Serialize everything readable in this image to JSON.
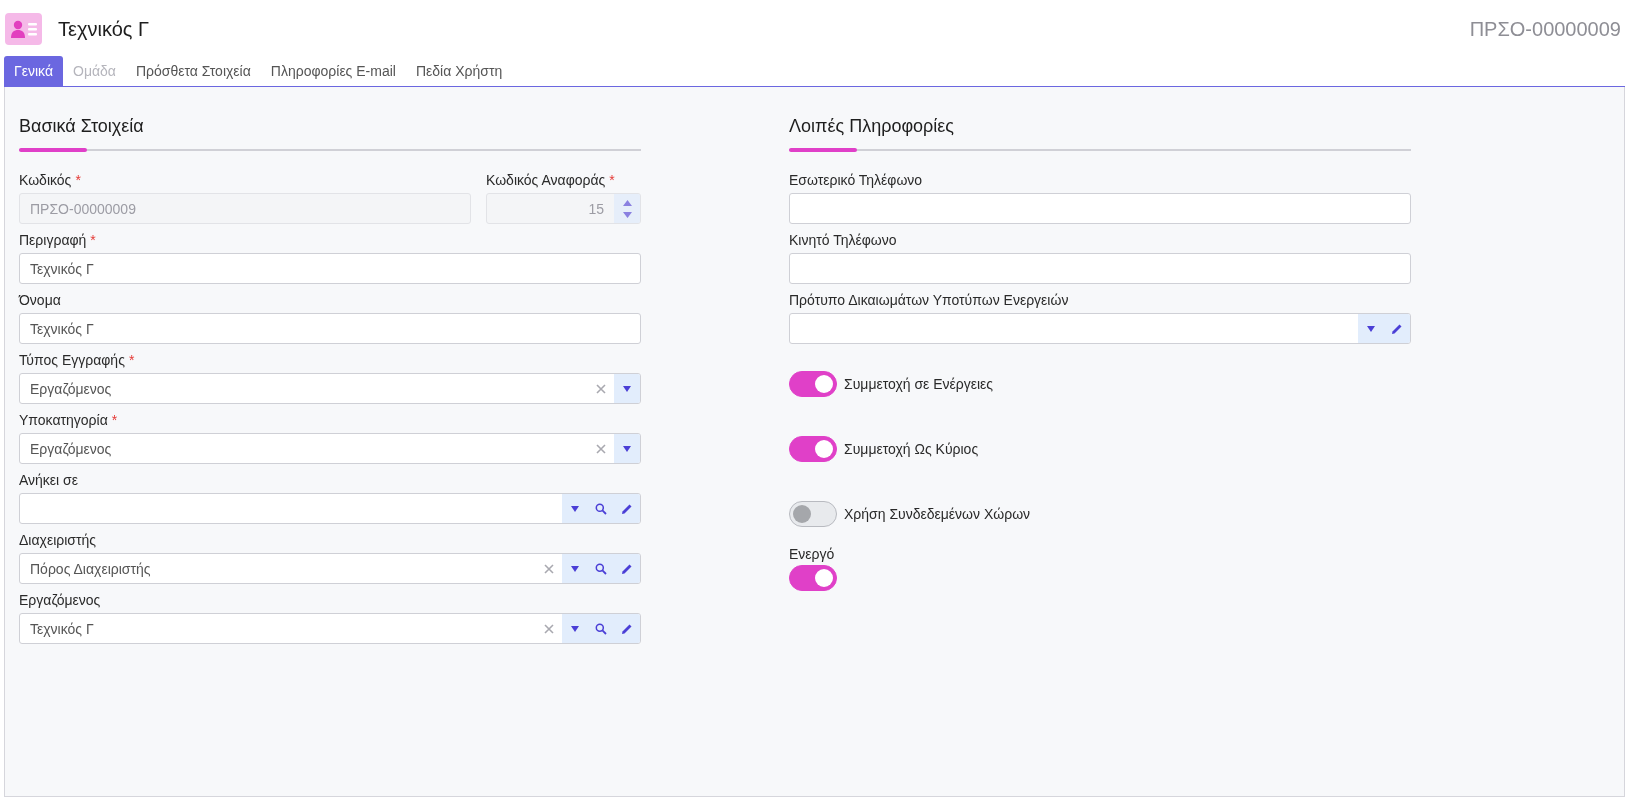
{
  "header": {
    "title": "Τεχνικός Γ",
    "code": "ΠΡΣΟ-00000009"
  },
  "tabs": [
    {
      "label": "Γενικά",
      "selected": true,
      "disabled": false
    },
    {
      "label": "Ομάδα",
      "selected": false,
      "disabled": true
    },
    {
      "label": "Πρόσθετα Στοιχεία",
      "selected": false,
      "disabled": false
    },
    {
      "label": "Πληροφορίες E-mail",
      "selected": false,
      "disabled": false
    },
    {
      "label": "Πεδία Χρήστη",
      "selected": false,
      "disabled": false
    }
  ],
  "left_section": {
    "title": "Βασικά Στοιχεία",
    "rows": [
      [
        {
          "label": "Κωδικός",
          "required_mark": "*",
          "kind": "text",
          "disabled": true,
          "value": "ΠΡΣΟ-00000009"
        },
        {
          "label": "Κωδικός Αναφοράς",
          "required_mark": "*",
          "kind": "number",
          "disabled": true,
          "value": "15"
        }
      ],
      [
        {
          "label": "Περιγραφή",
          "required_mark": "*",
          "kind": "text",
          "disabled": false,
          "value": "Τεχνικός Γ"
        }
      ],
      [
        {
          "label": "Όνομα",
          "kind": "text",
          "disabled": false,
          "value": "Τεχνικός Γ"
        }
      ],
      [
        {
          "label": "Τύπος Εγγραφής",
          "required_mark": "*",
          "kind": "select",
          "disabled": false,
          "value": "Εργαζόμενος",
          "clear_button": true,
          "dropdown_button": true
        }
      ],
      [
        {
          "label": "Υποκατηγορία",
          "required_mark": "*",
          "kind": "select",
          "disabled": false,
          "value": "Εργαζόμενος",
          "clear_button": true,
          "dropdown_button": true
        }
      ],
      [
        {
          "label": "Ανήκει σε",
          "kind": "select",
          "disabled": false,
          "dropdown_button": true,
          "search_button": true,
          "edit_button": true
        }
      ],
      [
        {
          "label": "Διαχειριστής",
          "kind": "select",
          "disabled": false,
          "value": "Πόρος Διαχειριστής",
          "clear_button": true,
          "dropdown_button": true,
          "search_button": true,
          "edit_button": true
        }
      ],
      [
        {
          "label": "Εργαζόμενος",
          "kind": "select",
          "disabled": false,
          "value": "Τεχνικός Γ",
          "clear_button": true,
          "dropdown_button": true,
          "search_button": true,
          "edit_button": true
        }
      ]
    ]
  },
  "right_section": {
    "title": "Λοιπές Πληροφορίες",
    "items": [
      {
        "kind": "text",
        "label": "Εσωτερικό Τηλέφωνο"
      },
      {
        "kind": "text",
        "label": "Κινητό Τηλέφωνο"
      },
      {
        "kind": "select",
        "label": "Πρότυπο Δικαιωμάτων Υποτύπων Ενεργειών",
        "dropdown_button": true,
        "edit_button": true
      },
      {
        "kind": "switch",
        "label": "Συμμετοχή σε Ενέργειες",
        "on": true
      },
      {
        "kind": "switch",
        "label": "Συμμετοχή Ως Κύριος",
        "on": true
      },
      {
        "kind": "switch",
        "label": "Χρήση Συνδεδεμένων Χώρων",
        "on": false
      },
      {
        "kind": "switch_stacked",
        "label": "Ενεργό",
        "on": true
      }
    ]
  }
}
